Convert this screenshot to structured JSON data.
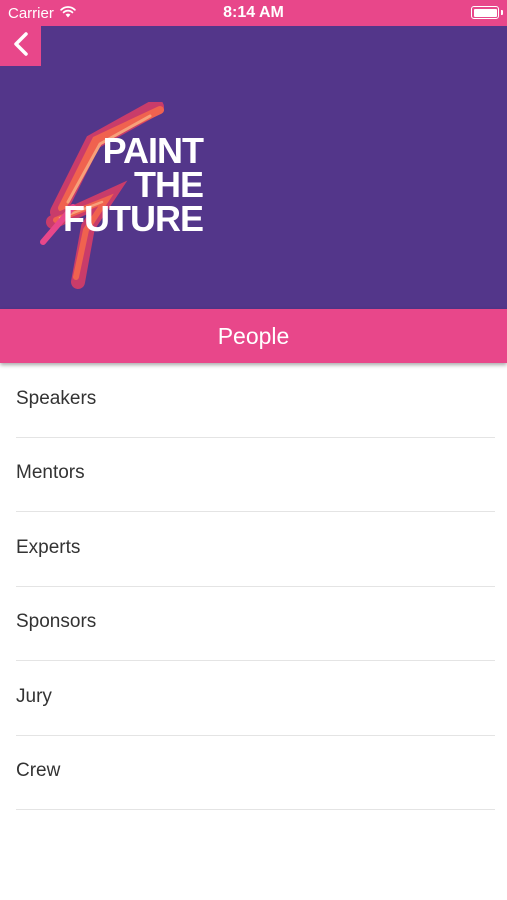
{
  "status_bar": {
    "carrier": "Carrier",
    "time": "8:14 AM",
    "icons": [
      "wifi-icon",
      "battery-icon"
    ]
  },
  "header": {
    "back_icon": "chevron-left-icon",
    "logo_lines": [
      "PAINT",
      "THE",
      "FUTURE"
    ],
    "background_color": "#53368a",
    "accent_color": "#e8478a"
  },
  "title": "People",
  "list": {
    "items": [
      {
        "label": "Speakers"
      },
      {
        "label": "Mentors"
      },
      {
        "label": "Experts"
      },
      {
        "label": "Sponsors"
      },
      {
        "label": "Jury"
      },
      {
        "label": "Crew"
      }
    ]
  }
}
